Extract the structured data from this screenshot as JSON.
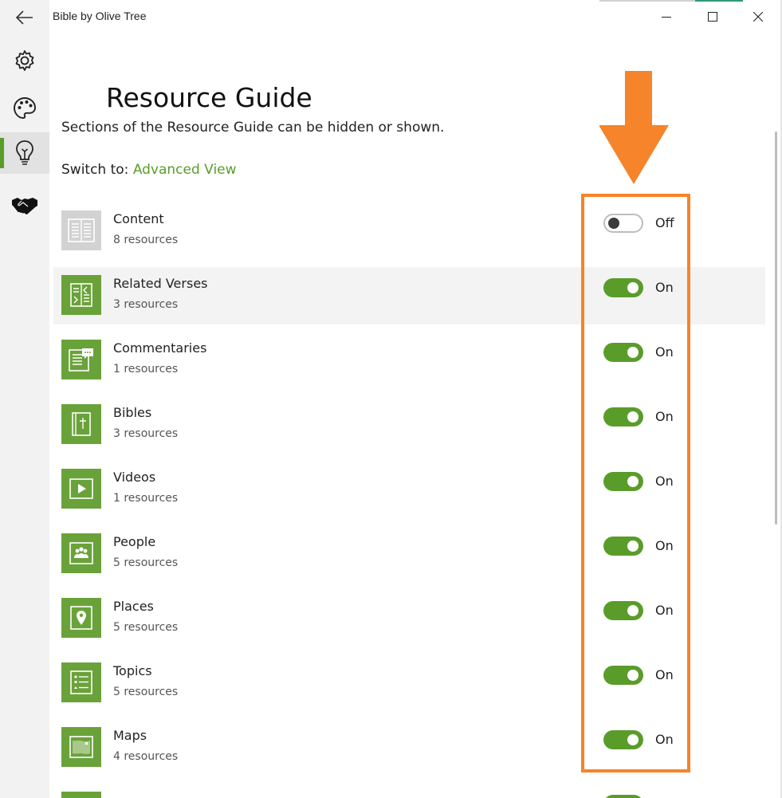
{
  "app": {
    "title": "Bible by Olive Tree"
  },
  "nav": [
    {
      "name": "back-icon"
    },
    {
      "name": "gear-icon"
    },
    {
      "name": "palette-icon"
    },
    {
      "name": "lightbulb-icon",
      "active": true
    },
    {
      "name": "handshake-icon"
    }
  ],
  "window_controls": [
    "minimize-icon",
    "maximize-icon",
    "close-icon"
  ],
  "page": {
    "title": "Resource Guide",
    "description": "Sections of the Resource Guide can be hidden or shown.",
    "switch_prefix": "Switch to:",
    "switch_link": "Advanced View"
  },
  "sections": [
    {
      "name": "Content",
      "count": "8 resources",
      "state": "Off",
      "on": false,
      "icon": "book-icon"
    },
    {
      "name": "Related Verses",
      "count": "3 resources",
      "state": "On",
      "on": true,
      "icon": "cross-reference-icon"
    },
    {
      "name": "Commentaries",
      "count": "1 resources",
      "state": "On",
      "on": true,
      "icon": "commentary-icon"
    },
    {
      "name": "Bibles",
      "count": "3 resources",
      "state": "On",
      "on": true,
      "icon": "bible-icon"
    },
    {
      "name": "Videos",
      "count": "1 resources",
      "state": "On",
      "on": true,
      "icon": "video-icon"
    },
    {
      "name": "People",
      "count": "5 resources",
      "state": "On",
      "on": true,
      "icon": "people-icon"
    },
    {
      "name": "Places",
      "count": "5 resources",
      "state": "On",
      "on": true,
      "icon": "map-pin-icon"
    },
    {
      "name": "Topics",
      "count": "5 resources",
      "state": "On",
      "on": true,
      "icon": "topics-list-icon"
    },
    {
      "name": "Maps",
      "count": "4 resources",
      "state": "On",
      "on": true,
      "icon": "map-icon"
    }
  ],
  "colors": {
    "accent": "#5a9c2a",
    "icon_bg": "#6aa23a",
    "annotation": "#f5842a",
    "rail_bg": "#f2f2f2"
  }
}
